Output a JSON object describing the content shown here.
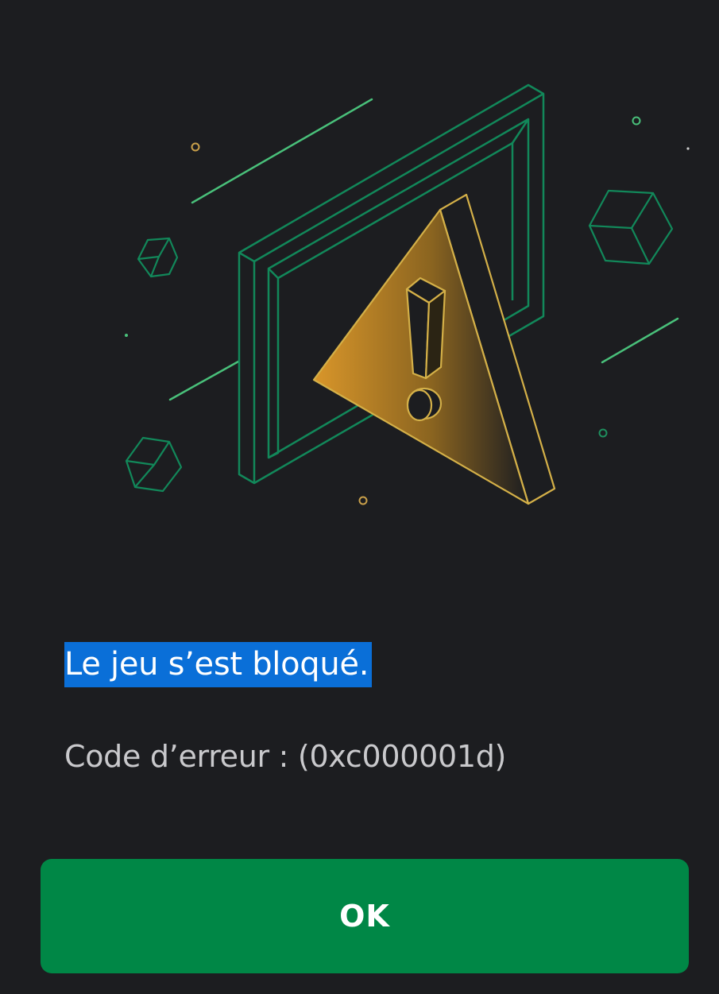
{
  "dialog": {
    "title": "Le jeu s’est bloqué.",
    "error_code": "Code d’erreur : (0xc000001d)",
    "ok_label": "OK"
  },
  "illustration": {
    "icon": "warning-triangle-icon",
    "frame_icon": "window-frame-icon",
    "decor_icon": "cube-icon"
  },
  "colors": {
    "background": "#1c1d20",
    "accent_green": "#008746",
    "line_green": "#1e8f5e",
    "warning_gold": "#d9a238",
    "selection_blue": "#0a6fd8"
  }
}
